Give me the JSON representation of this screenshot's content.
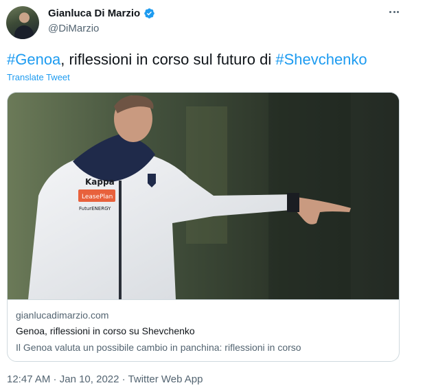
{
  "author": {
    "display_name": "Gianluca Di Marzio",
    "handle": "@DiMarzio",
    "verified_icon": "verified-badge-icon"
  },
  "tweet": {
    "hashtag_1": "#Genoa",
    "text_middle": ", riflessioni in corso sul futuro di ",
    "hashtag_2": "#Shevchenko",
    "translate_label": "Translate Tweet"
  },
  "card": {
    "image_icon": "coach-photo",
    "jacket_brand": "Kappa",
    "sponsor_1": "LeasePlan",
    "sponsor_2": "FuturENERGY",
    "domain": "gianlucadimarzio.com",
    "title": "Genoa, riflessioni in corso su Shevchenko",
    "description": "Il Genoa valuta un possibile cambio in panchina: riflessioni in corso"
  },
  "footer": {
    "time": "12:47 AM",
    "separator_1": " · ",
    "date": "Jan 10, 2022",
    "separator_2": " · ",
    "source": "Twitter Web App"
  },
  "colors": {
    "accent": "#1d9bf0",
    "secondary_text": "#536471",
    "border": "#cfd9de"
  }
}
